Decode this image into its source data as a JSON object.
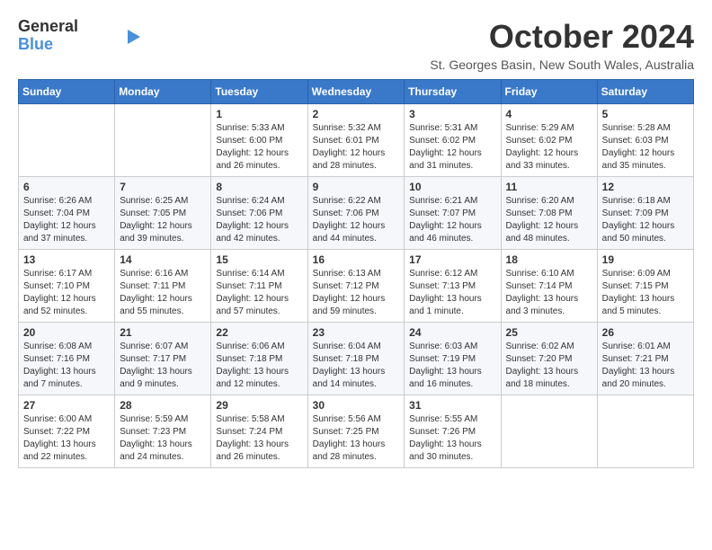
{
  "logo": {
    "line1": "General",
    "line2": "Blue"
  },
  "title": "October 2024",
  "subtitle": "St. Georges Basin, New South Wales, Australia",
  "days_of_week": [
    "Sunday",
    "Monday",
    "Tuesday",
    "Wednesday",
    "Thursday",
    "Friday",
    "Saturday"
  ],
  "weeks": [
    [
      {
        "day": "",
        "info": ""
      },
      {
        "day": "",
        "info": ""
      },
      {
        "day": "1",
        "info": "Sunrise: 5:33 AM\nSunset: 6:00 PM\nDaylight: 12 hours\nand 26 minutes."
      },
      {
        "day": "2",
        "info": "Sunrise: 5:32 AM\nSunset: 6:01 PM\nDaylight: 12 hours\nand 28 minutes."
      },
      {
        "day": "3",
        "info": "Sunrise: 5:31 AM\nSunset: 6:02 PM\nDaylight: 12 hours\nand 31 minutes."
      },
      {
        "day": "4",
        "info": "Sunrise: 5:29 AM\nSunset: 6:02 PM\nDaylight: 12 hours\nand 33 minutes."
      },
      {
        "day": "5",
        "info": "Sunrise: 5:28 AM\nSunset: 6:03 PM\nDaylight: 12 hours\nand 35 minutes."
      }
    ],
    [
      {
        "day": "6",
        "info": "Sunrise: 6:26 AM\nSunset: 7:04 PM\nDaylight: 12 hours\nand 37 minutes."
      },
      {
        "day": "7",
        "info": "Sunrise: 6:25 AM\nSunset: 7:05 PM\nDaylight: 12 hours\nand 39 minutes."
      },
      {
        "day": "8",
        "info": "Sunrise: 6:24 AM\nSunset: 7:06 PM\nDaylight: 12 hours\nand 42 minutes."
      },
      {
        "day": "9",
        "info": "Sunrise: 6:22 AM\nSunset: 7:06 PM\nDaylight: 12 hours\nand 44 minutes."
      },
      {
        "day": "10",
        "info": "Sunrise: 6:21 AM\nSunset: 7:07 PM\nDaylight: 12 hours\nand 46 minutes."
      },
      {
        "day": "11",
        "info": "Sunrise: 6:20 AM\nSunset: 7:08 PM\nDaylight: 12 hours\nand 48 minutes."
      },
      {
        "day": "12",
        "info": "Sunrise: 6:18 AM\nSunset: 7:09 PM\nDaylight: 12 hours\nand 50 minutes."
      }
    ],
    [
      {
        "day": "13",
        "info": "Sunrise: 6:17 AM\nSunset: 7:10 PM\nDaylight: 12 hours\nand 52 minutes."
      },
      {
        "day": "14",
        "info": "Sunrise: 6:16 AM\nSunset: 7:11 PM\nDaylight: 12 hours\nand 55 minutes."
      },
      {
        "day": "15",
        "info": "Sunrise: 6:14 AM\nSunset: 7:11 PM\nDaylight: 12 hours\nand 57 minutes."
      },
      {
        "day": "16",
        "info": "Sunrise: 6:13 AM\nSunset: 7:12 PM\nDaylight: 12 hours\nand 59 minutes."
      },
      {
        "day": "17",
        "info": "Sunrise: 6:12 AM\nSunset: 7:13 PM\nDaylight: 13 hours\nand 1 minute."
      },
      {
        "day": "18",
        "info": "Sunrise: 6:10 AM\nSunset: 7:14 PM\nDaylight: 13 hours\nand 3 minutes."
      },
      {
        "day": "19",
        "info": "Sunrise: 6:09 AM\nSunset: 7:15 PM\nDaylight: 13 hours\nand 5 minutes."
      }
    ],
    [
      {
        "day": "20",
        "info": "Sunrise: 6:08 AM\nSunset: 7:16 PM\nDaylight: 13 hours\nand 7 minutes."
      },
      {
        "day": "21",
        "info": "Sunrise: 6:07 AM\nSunset: 7:17 PM\nDaylight: 13 hours\nand 9 minutes."
      },
      {
        "day": "22",
        "info": "Sunrise: 6:06 AM\nSunset: 7:18 PM\nDaylight: 13 hours\nand 12 minutes."
      },
      {
        "day": "23",
        "info": "Sunrise: 6:04 AM\nSunset: 7:18 PM\nDaylight: 13 hours\nand 14 minutes."
      },
      {
        "day": "24",
        "info": "Sunrise: 6:03 AM\nSunset: 7:19 PM\nDaylight: 13 hours\nand 16 minutes."
      },
      {
        "day": "25",
        "info": "Sunrise: 6:02 AM\nSunset: 7:20 PM\nDaylight: 13 hours\nand 18 minutes."
      },
      {
        "day": "26",
        "info": "Sunrise: 6:01 AM\nSunset: 7:21 PM\nDaylight: 13 hours\nand 20 minutes."
      }
    ],
    [
      {
        "day": "27",
        "info": "Sunrise: 6:00 AM\nSunset: 7:22 PM\nDaylight: 13 hours\nand 22 minutes."
      },
      {
        "day": "28",
        "info": "Sunrise: 5:59 AM\nSunset: 7:23 PM\nDaylight: 13 hours\nand 24 minutes."
      },
      {
        "day": "29",
        "info": "Sunrise: 5:58 AM\nSunset: 7:24 PM\nDaylight: 13 hours\nand 26 minutes."
      },
      {
        "day": "30",
        "info": "Sunrise: 5:56 AM\nSunset: 7:25 PM\nDaylight: 13 hours\nand 28 minutes."
      },
      {
        "day": "31",
        "info": "Sunrise: 5:55 AM\nSunset: 7:26 PM\nDaylight: 13 hours\nand 30 minutes."
      },
      {
        "day": "",
        "info": ""
      },
      {
        "day": "",
        "info": ""
      }
    ]
  ]
}
